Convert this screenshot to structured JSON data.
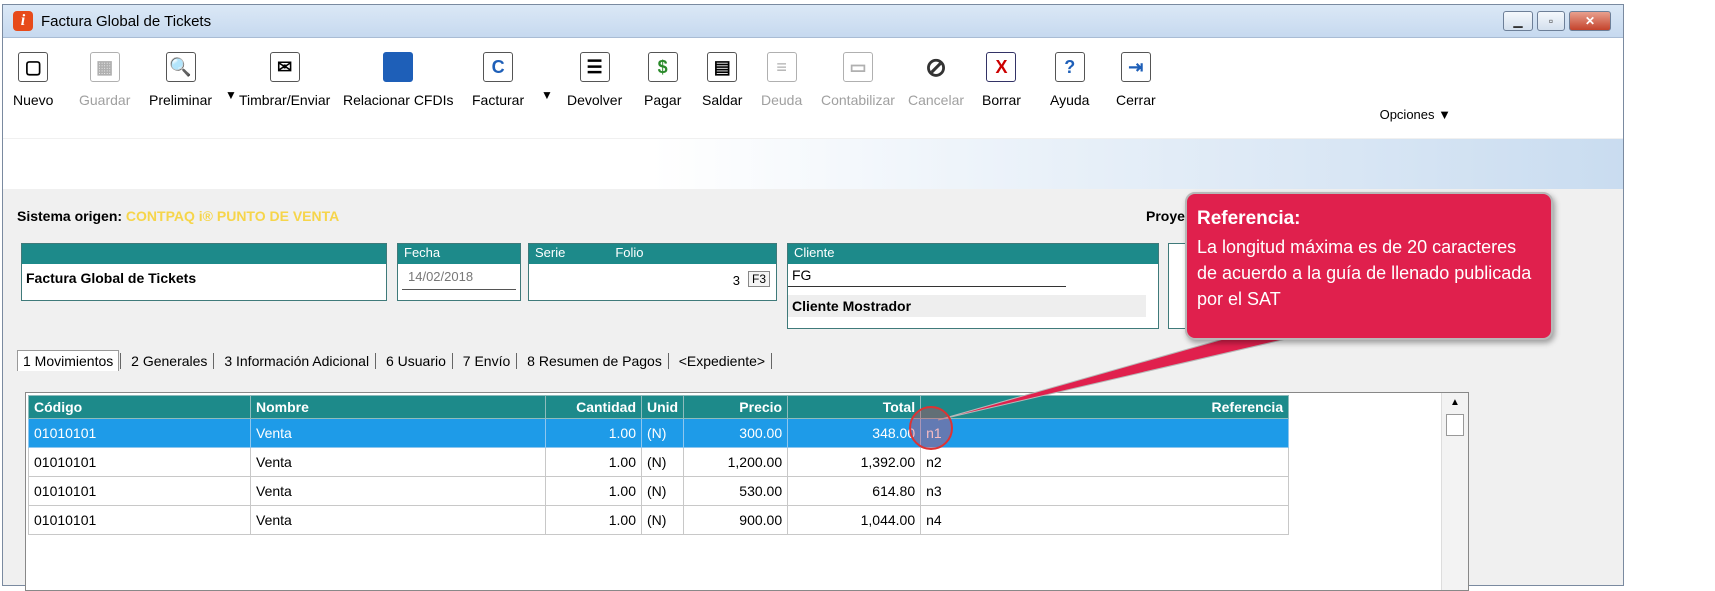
{
  "window": {
    "title": "Factura Global de Tickets"
  },
  "toolbar": {
    "buttons": [
      {
        "label": "Nuevo",
        "icon": "new-document-icon",
        "enabled": true
      },
      {
        "label": "Guardar",
        "icon": "save-icon",
        "enabled": false
      },
      {
        "label": "Preliminar",
        "icon": "preview-icon",
        "enabled": true
      },
      {
        "label": "Timbrar/Enviar",
        "icon": "stamp-send-icon",
        "enabled": true
      },
      {
        "label": "Relacionar CFDIs",
        "icon": "relate-cfdi-icon",
        "enabled": true
      },
      {
        "label": "Facturar",
        "icon": "invoice-icon",
        "enabled": true
      },
      {
        "label": "Devolver",
        "icon": "return-icon",
        "enabled": true
      },
      {
        "label": "Pagar",
        "icon": "pay-icon",
        "enabled": true
      },
      {
        "label": "Saldar",
        "icon": "settle-icon",
        "enabled": true
      },
      {
        "label": "Deuda",
        "icon": "debt-icon",
        "enabled": false
      },
      {
        "label": "Contabilizar",
        "icon": "accounting-icon",
        "enabled": false
      },
      {
        "label": "Cancelar",
        "icon": "cancel-icon",
        "enabled": false
      },
      {
        "label": "Borrar",
        "icon": "delete-icon",
        "enabled": true
      },
      {
        "label": "Ayuda",
        "icon": "help-icon",
        "enabled": true
      },
      {
        "label": "Cerrar",
        "icon": "close-door-icon",
        "enabled": true
      }
    ],
    "options_label": "Opciones ▼"
  },
  "origin": {
    "label": "Sistema origen:",
    "value": "CONTPAQ i® PUNTO DE VENTA"
  },
  "proyecto_label": "Proyecto:",
  "doc": {
    "name": "Factura Global de Tickets",
    "fecha_label": "Fecha",
    "fecha": "14/02/2018",
    "serie_label": "Serie",
    "folio_label": "Folio",
    "folio": "3",
    "f3": "F3",
    "cliente_label": "Cliente",
    "cliente_code": "FG",
    "cliente_name": "Cliente Mostrador"
  },
  "tabs": [
    "1 Movimientos",
    "2 Generales",
    "3 Información Adicional",
    "6 Usuario",
    "7 Envío",
    "8 Resumen de Pagos",
    "<Expediente>"
  ],
  "table": {
    "headers": [
      "Código",
      "Nombre",
      "Cantidad",
      "Unid",
      "Precio",
      "Total",
      "Referencia"
    ],
    "rows": [
      [
        "01010101",
        "Venta",
        "1.00",
        "(N)",
        "300.00",
        "348.00",
        "n1"
      ],
      [
        "01010101",
        "Venta",
        "1.00",
        "(N)",
        "1,200.00",
        "1,392.00",
        "n2"
      ],
      [
        "01010101",
        "Venta",
        "1.00",
        "(N)",
        "530.00",
        "614.80",
        "n3"
      ],
      [
        "01010101",
        "Venta",
        "1.00",
        "(N)",
        "900.00",
        "1,044.00",
        "n4"
      ]
    ]
  },
  "callout": {
    "title": "Referencia:",
    "text": "La longitud máxima es de 20 caracteres de acuerdo a la guía de llenado publicada por el SAT"
  },
  "colors": {
    "teal": "#1d8a8a",
    "selection": "#1e9be8",
    "callout": "#e0204d"
  }
}
